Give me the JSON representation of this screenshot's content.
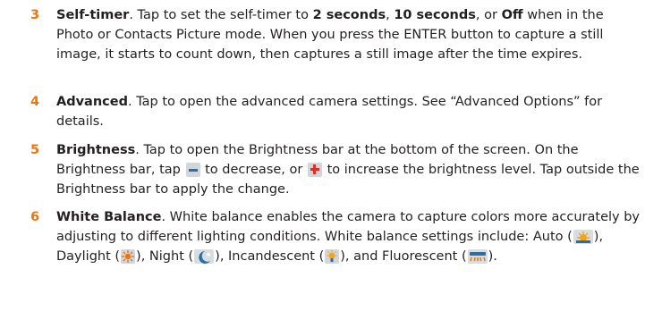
{
  "items": [
    {
      "number": "3",
      "title": "Self-timer",
      "text_a": ". Tap to set the self-timer to ",
      "bold_a": "2 seconds",
      "text_b": ", ",
      "bold_b": "10 seconds",
      "text_c": ", or ",
      "bold_c": "Off",
      "text_d": " when in the Photo or Contacts Picture mode. When you press the ENTER button to capture a still image, it starts to count down, then captures a still image after the time expires."
    },
    {
      "number": "4",
      "title": "Advanced",
      "text": ". Tap to open the advanced camera settings. See “Advanced Options” for details."
    },
    {
      "number": "5",
      "title": "Brightness",
      "text_a": ". Tap to open the Brightness bar at the bottom of the screen. On the Brightness bar, tap ",
      "text_b": " to decrease, or ",
      "text_c": " to increase the brightness level. Tap outside the Brightness bar to apply the change."
    },
    {
      "number": "6",
      "title": "White Balance",
      "text_a": ". White balance enables the camera to capture colors more accurately by adjusting to different lighting conditions. White balance settings include: Auto (",
      "text_b": "), Daylight (",
      "text_c": "), Night (",
      "text_d": "), Incandescent (",
      "text_e": "), and Fluorescent (",
      "text_f": ")."
    }
  ],
  "icons": {
    "minus": "minus-icon",
    "plus": "plus-icon",
    "auto": "auto-white-balance-icon",
    "daylight": "daylight-icon",
    "night": "night-icon",
    "incandescent": "incandescent-icon",
    "fluorescent": "fluorescent-icon"
  },
  "colors": {
    "number": "#e8760d",
    "text": "#231f20"
  }
}
